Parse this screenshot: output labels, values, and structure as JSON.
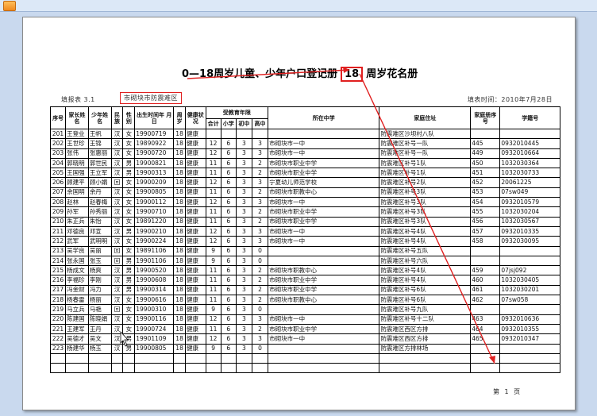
{
  "title": {
    "prefix": "0—18周岁儿童、少年户口登记册",
    "highlight": "18",
    "suffix": "周岁花名册"
  },
  "meta": {
    "left": "填报表 3.1",
    "boxed": "市砌块市防震难区",
    "right": "填表时间：2010年7月28日"
  },
  "headers": {
    "seq": "序号",
    "head": "家长姓名",
    "child": "少年姓名",
    "ethnic": "民族",
    "gender": "性别",
    "birth": "出生时间年 月 日",
    "age": "周岁",
    "health": "健康状况",
    "edu_group": "受教育年限",
    "edu_total": "合计",
    "edu_primary": "小学",
    "edu_junior": "初中",
    "edu_senior": "高中",
    "school": "所在中学",
    "address": "家庭住址",
    "household": "家庭册序号",
    "student_no": "学籍号"
  },
  "rows": [
    [
      "201",
      "王登业",
      "王帆",
      "汉",
      "女",
      "19900719",
      "18",
      "健康",
      "",
      "",
      "",
      "",
      "",
      "防震难区沙坝村八队",
      "",
      ""
    ],
    [
      "202",
      "王世珍",
      "王锦",
      "汉",
      "女",
      "19890922",
      "18",
      "健康",
      "12",
      "6",
      "3",
      "3",
      "市砌块市一中",
      "防震难区补号一队",
      "445",
      "0932010445"
    ],
    [
      "203",
      "张伟",
      "张惠丽",
      "汉",
      "女",
      "19900720",
      "18",
      "健康",
      "12",
      "6",
      "3",
      "3",
      "市砌块市一中",
      "防震难区补号一队",
      "449",
      "0932010664"
    ],
    [
      "204",
      "郭晓明",
      "郭世民",
      "汉",
      "男",
      "19900821",
      "18",
      "健康",
      "11",
      "6",
      "3",
      "2",
      "市砌块市职业中学",
      "防震难区补号1队",
      "450",
      "1032030364"
    ],
    [
      "205",
      "王国强",
      "王立军",
      "汉",
      "男",
      "19900313",
      "18",
      "健康",
      "11",
      "6",
      "3",
      "2",
      "市砌块市职业中学",
      "防震难区补号1队",
      "451",
      "1032030733"
    ],
    [
      "206",
      "顾建平",
      "顾小娟",
      "回",
      "女",
      "19900209",
      "18",
      "健康",
      "12",
      "6",
      "3",
      "3",
      "宁夏幼儿师范学校",
      "防震难区补号2队",
      "452",
      "20061225"
    ],
    [
      "207",
      "余国明",
      "余丹",
      "汉",
      "女",
      "19900805",
      "18",
      "健康",
      "11",
      "6",
      "3",
      "2",
      "市砌块市职教中心",
      "防震难区补号3队",
      "453",
      "07sw049"
    ],
    [
      "208",
      "赵林",
      "赵春梅",
      "汉",
      "女",
      "19900112",
      "18",
      "健康",
      "12",
      "6",
      "3",
      "3",
      "市砌块市一中",
      "防震难区补号3队",
      "454",
      "0932010579"
    ],
    [
      "209",
      "孙军",
      "孙秀丽",
      "汉",
      "女",
      "19900710",
      "18",
      "健康",
      "11",
      "6",
      "3",
      "2",
      "市砌块市职业中学",
      "防震难区补号3队",
      "455",
      "1032030204"
    ],
    [
      "210",
      "朱正兵",
      "朱怡",
      "汉",
      "女",
      "19891220",
      "18",
      "健康",
      "11",
      "6",
      "3",
      "2",
      "市砌块市职业中学",
      "防震难区补号3队",
      "456",
      "1032030567"
    ],
    [
      "211",
      "邓德良",
      "邓宣",
      "汉",
      "男",
      "19900210",
      "18",
      "健康",
      "12",
      "6",
      "3",
      "3",
      "市砌块市一中",
      "防震难区补号4队",
      "457",
      "0932010335"
    ],
    [
      "212",
      "武军",
      "武明明",
      "汉",
      "女",
      "19900224",
      "18",
      "健康",
      "12",
      "6",
      "3",
      "3",
      "市砌块市一中",
      "防震难区补号4队",
      "458",
      "0932030095"
    ],
    [
      "213",
      "吴学良",
      "吴丽",
      "回",
      "女",
      "19891106",
      "18",
      "健康",
      "9",
      "6",
      "3",
      "0",
      "",
      "防震难区补号五队",
      "",
      ""
    ],
    [
      "214",
      "张永国",
      "张玉",
      "回",
      "男",
      "19901106",
      "18",
      "健康",
      "9",
      "6",
      "3",
      "0",
      "",
      "防震难区补号六队",
      "",
      ""
    ],
    [
      "215",
      "杨成文",
      "杨爽",
      "汉",
      "男",
      "19900520",
      "18",
      "健康",
      "11",
      "6",
      "3",
      "2",
      "市砌块市职教中心",
      "防震难区补号4队",
      "459",
      "07jsj092"
    ],
    [
      "216",
      "李福珍",
      "李刚",
      "汉",
      "男",
      "19900608",
      "18",
      "健康",
      "11",
      "6",
      "3",
      "2",
      "市砌块市职业中学",
      "防震难区补号4队",
      "460",
      "1032030405"
    ],
    [
      "217",
      "冯金财",
      "冯力",
      "汉",
      "男",
      "19900314",
      "18",
      "健康",
      "11",
      "6",
      "3",
      "2",
      "市砌块市职业中学",
      "防震难区补号6队",
      "461",
      "1032030201"
    ],
    [
      "218",
      "杨春雷",
      "杨丽",
      "汉",
      "女",
      "19900616",
      "18",
      "健康",
      "11",
      "6",
      "3",
      "2",
      "市砌块市职教中心",
      "防震难区补号6队",
      "462",
      "07sw058"
    ],
    [
      "219",
      "马立兵",
      "马艳",
      "回",
      "女",
      "19900310",
      "18",
      "健康",
      "9",
      "6",
      "3",
      "0",
      "",
      "防震难区补号九队",
      "",
      ""
    ],
    [
      "220",
      "陈建国",
      "陈晓娟",
      "汉",
      "女",
      "19900116",
      "18",
      "健康",
      "12",
      "6",
      "3",
      "3",
      "市砌块市一中",
      "防震难区补号十二队",
      "463",
      "0932010636"
    ],
    [
      "221",
      "王建军",
      "王丹",
      "汉",
      "女",
      "19900724",
      "18",
      "健康",
      "11",
      "6",
      "3",
      "2",
      "市砌块市职业中学",
      "防震难区西区方排",
      "464",
      "0932010355"
    ],
    [
      "222",
      "吴德才",
      "吴文",
      "汉",
      "男",
      "19901109",
      "18",
      "健康",
      "12",
      "6",
      "3",
      "3",
      "市砌块市一中",
      "防震难区西区方排",
      "465",
      "0932010347"
    ],
    [
      "223",
      "杨建华",
      "杨玉",
      "汉",
      "男",
      "19900805",
      "18",
      "健康",
      "9",
      "6",
      "3",
      "0",
      "",
      "防震难区方排林场",
      "",
      ""
    ],
    [
      "",
      "",
      "",
      "",
      "",
      "",
      "",
      "",
      "",
      "",
      "",
      "",
      "",
      "",
      "",
      ""
    ],
    [
      "",
      "",
      "",
      "",
      "",
      "",
      "",
      "",
      "",
      "",
      "",
      "",
      "",
      "",
      "",
      ""
    ]
  ],
  "footer": "第 1 页"
}
